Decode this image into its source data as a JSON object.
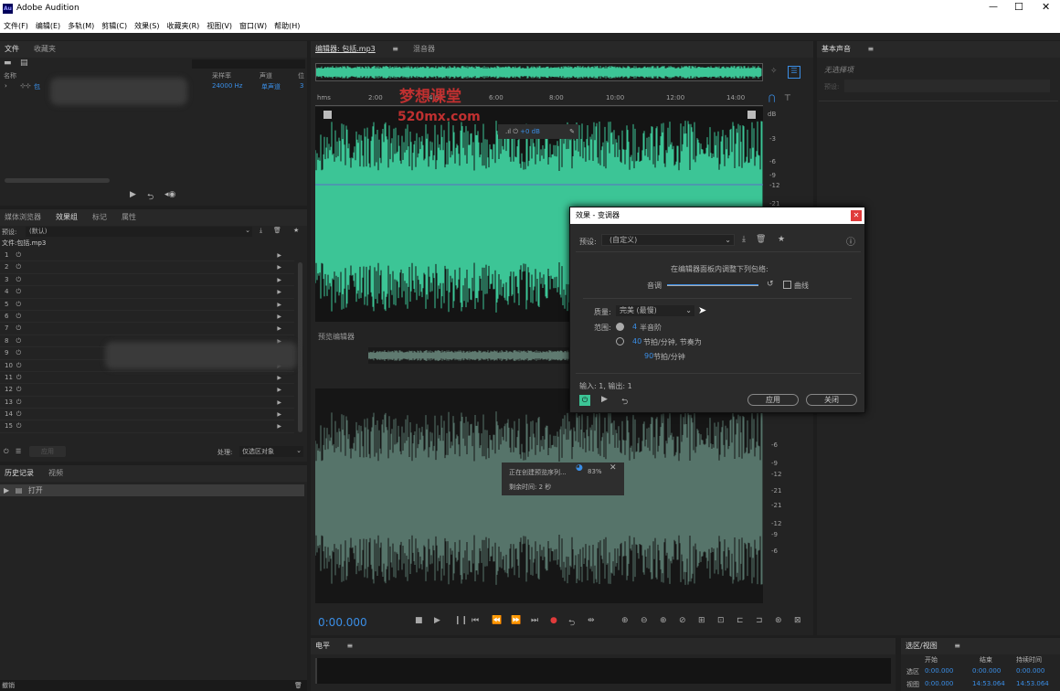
{
  "app": {
    "title": "Adobe Audition",
    "logo": "Au"
  },
  "menu": [
    "文件(F)",
    "编辑(E)",
    "多轨(M)",
    "剪辑(C)",
    "效果(S)",
    "收藏夹(R)",
    "视图(V)",
    "窗口(W)",
    "帮助(H)"
  ],
  "files_panel": {
    "tabs": [
      "文件",
      "收藏夹"
    ],
    "columns": {
      "name": "名称",
      "rate": "采样率",
      "channel": "声道",
      "bits": "位"
    },
    "row": {
      "name": "包",
      "rate": "24000 Hz",
      "channel": "单声道",
      "bits": "3"
    }
  },
  "effects_panel": {
    "tabs": [
      "媒体浏览器",
      "效果组",
      "标记",
      "属性"
    ],
    "preset_label": "预设:",
    "preset_value": "(默认)",
    "file_label": "文件:包括.mp3",
    "rows": [
      "1",
      "2",
      "3",
      "4",
      "5",
      "6",
      "7",
      "8",
      "9",
      "10",
      "11",
      "12",
      "13",
      "14",
      "15"
    ],
    "apply": "应用",
    "process_label": "处理:",
    "process_value": "仅选区对象"
  },
  "history_panel": {
    "tabs": [
      "历史记录",
      "视频"
    ],
    "item": "打开"
  },
  "status": {
    "left": "撤销"
  },
  "editor": {
    "tabs": [
      "编辑器: 包括.mp3",
      "混音器"
    ],
    "ruler": [
      "hms",
      "2:00",
      "4:00",
      "6:00",
      "8:00",
      "10:00",
      "12:00",
      "14:00"
    ],
    "db": [
      "dB",
      "-3",
      "-6",
      "-9",
      "-12",
      "-21"
    ],
    "hud_gain": "+0 dB",
    "watermark_cn": "梦想课堂",
    "watermark_url": "520mx.com",
    "time": "0:00.000",
    "preview_label": "预览编辑器",
    "preview_db": [
      "-6",
      "-9",
      "-12",
      "-21",
      "-21",
      "-12",
      "-9",
      "-6"
    ]
  },
  "progress": {
    "text": "正在创建预览序列...",
    "percent": "83%",
    "remaining": "剩余时间: 2 秒"
  },
  "dialog": {
    "title": "效果 - 变调器",
    "preset_label": "预设:",
    "preset_value": "(自定义)",
    "heading": "在编辑器面板内调整下列包络:",
    "pitch_label": "音调",
    "curve_label": "曲线",
    "quality_label": "质量:",
    "quality_value": "完美 (最慢)",
    "range_label": "范围:",
    "opt1_value": "4",
    "opt1_text": "半音阶",
    "opt2_value": "40",
    "opt2_text": "节拍/分钟, 节奏为",
    "opt2_value2": "90",
    "opt2_text2": "节拍/分钟",
    "io": "输入: 1, 输出: 1",
    "apply": "应用",
    "close": "关闭"
  },
  "right_panel": {
    "title": "基本声音",
    "subtitle": "无选择项",
    "preset": "预设:"
  },
  "levels": {
    "title": "电平"
  },
  "selection": {
    "title": "选区/视图",
    "col_start": "开始",
    "col_end": "结束",
    "col_dur": "持续时间",
    "row1": "选区",
    "row2": "视图",
    "sel_start": "0:00.000",
    "sel_end": "0:00.000",
    "sel_dur": "0:00.000",
    "view_start": "0:00.000",
    "view_end": "14:53.064",
    "view_dur": "14:53.064"
  },
  "colors": {
    "wave": "#3cc596",
    "accent": "#3a8ee6",
    "record": "#e03b3b"
  }
}
